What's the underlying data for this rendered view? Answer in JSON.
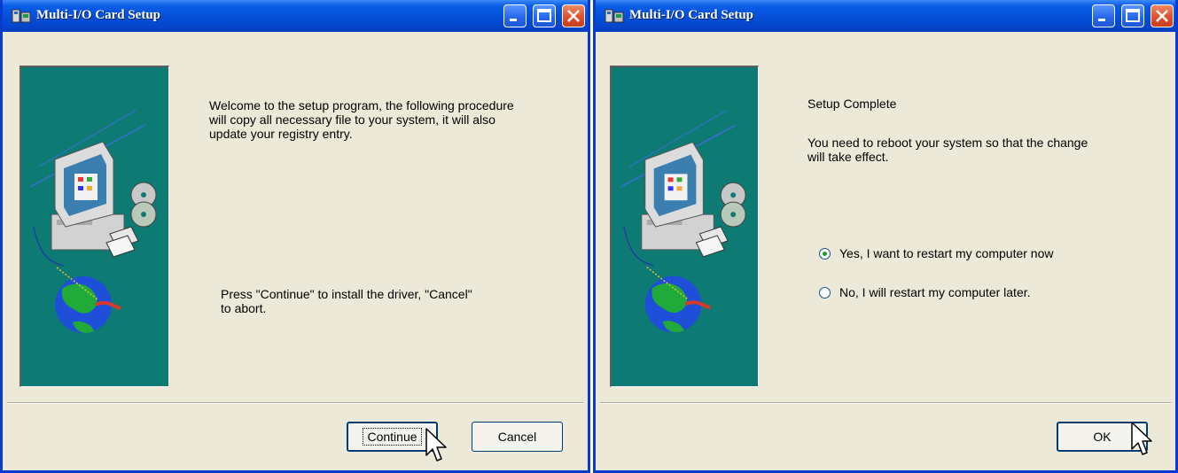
{
  "dialogs": [
    {
      "title": "Multi-I/O Card Setup",
      "welcome_text": "Welcome to the setup program, the following procedure\nwill copy all necessary file to your system, it will also\nupdate your registry entry.",
      "instruction_text": "Press \"Continue\" to install the driver, \"Cancel\"\nto abort.",
      "buttons": {
        "continue": "Continue",
        "cancel": "Cancel"
      }
    },
    {
      "title": "Multi-I/O Card Setup",
      "heading": "Setup Complete",
      "message": "You need to reboot your system so that the change\nwill take effect.",
      "options": [
        {
          "label": "Yes, I want to restart my computer now",
          "checked": true
        },
        {
          "label": "No, I will restart my computer later.",
          "checked": false
        }
      ],
      "buttons": {
        "ok": "OK"
      }
    }
  ],
  "colors": {
    "titlebar": "#0553dd",
    "window_border": "#0a3bd0",
    "panel": "#0e7a74",
    "dialog_bg": "#ece9d8"
  },
  "icons": [
    "app-icon",
    "minimize-icon",
    "maximize-icon",
    "close-icon",
    "computer-icon",
    "cd-disc-icon",
    "floppy-disk-icon",
    "globe-icon",
    "mouse-cursor-icon"
  ]
}
